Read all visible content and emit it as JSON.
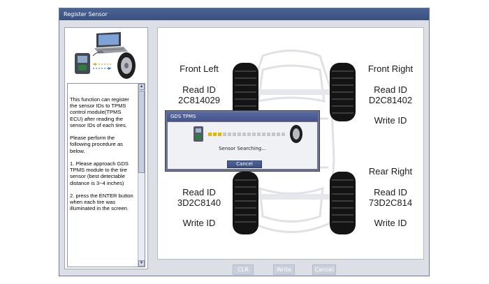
{
  "window": {
    "title": "Register Sensor"
  },
  "description": "This function can register the sensor IDs to TPMS control module(TPMS ECU) after reading the sensor IDs of each tires.\n\nPlease perform the following procedure as below.\n\n1. Please approach GDS TPMS module to the tire sensor (best detectable distance is 3~4 inches)\n\n2. press the ENTER button when each tire was illuminated in the screen.",
  "tires": {
    "front_left": {
      "name": "Front Left",
      "read_label": "Read ID",
      "read_id": "2C814029"
    },
    "front_right": {
      "name": "Front Right",
      "read_label": "Read ID",
      "read_id": "D2C81402",
      "write_label": "Write ID"
    },
    "rear_left": {
      "read_label": "Read ID",
      "read_id": "3D2C8140",
      "write_label": "Write ID"
    },
    "rear_right": {
      "name": "Rear Right",
      "read_label": "Read ID",
      "read_id": "73D2C814",
      "write_label": "Write ID"
    }
  },
  "buttons": {
    "clr": "CLR",
    "write": "Write",
    "cancel": "Cancel"
  },
  "dialog": {
    "title": "GDS TPMS",
    "message": "Sensor Searching...",
    "cancel": "Cancel",
    "progress_lit": 3,
    "progress_total": 16
  },
  "colors": {
    "titlebar": "#3a5280",
    "progress_on": "#e8b400",
    "progress_off": "#c4c6cc",
    "button_disabled": "#c9cfdb"
  },
  "icons": [
    "laptop-icon",
    "tpms-module-icon",
    "tire-icon",
    "scroll-up-icon",
    "scroll-down-icon"
  ]
}
